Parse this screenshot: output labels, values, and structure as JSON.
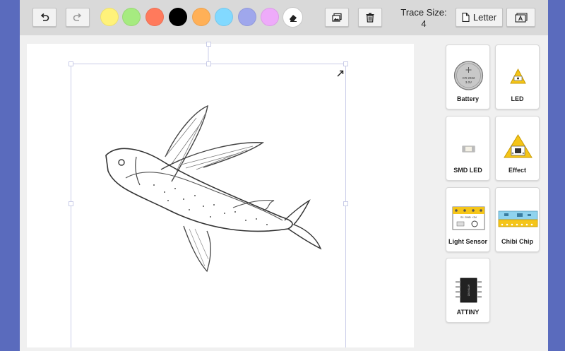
{
  "toolbar": {
    "undo_icon": "undo-icon",
    "redo_icon": "redo-icon",
    "colors": [
      "#fff27a",
      "#a6eb80",
      "#ff7a5c",
      "#000000",
      "#ffb057",
      "#82d9ff",
      "#9fa7ec",
      "#eeabfa"
    ],
    "eraser_icon": "eraser-icon",
    "image_icon": "image-icon",
    "trash_icon": "trash-icon",
    "trace_size_label": "Trace Size:",
    "trace_size_value": "4",
    "paper_label": "Letter",
    "paper_icon": "page-icon",
    "text_icon": "text-frame-icon"
  },
  "parts": [
    {
      "label": "Battery",
      "icon": "battery-icon",
      "chip_text_1": "CR 2032",
      "chip_text_2": "3.0V"
    },
    {
      "label": "LED",
      "icon": "led-icon"
    },
    {
      "label": "SMD LED",
      "icon": "smd-led-icon"
    },
    {
      "label": "Effect",
      "icon": "effect-icon"
    },
    {
      "label": "Light Sensor",
      "icon": "light-sensor-icon",
      "pin_text": "S1  GND  +3V"
    },
    {
      "label": "Chibi Chip",
      "icon": "chibi-chip-icon"
    },
    {
      "label": "ATTINY",
      "icon": "attiny-icon",
      "chip_text": "ATTINY85"
    }
  ],
  "canvas": {
    "image": "flying-fish-sketch",
    "resize_icon": "resize-arrow-icon"
  }
}
